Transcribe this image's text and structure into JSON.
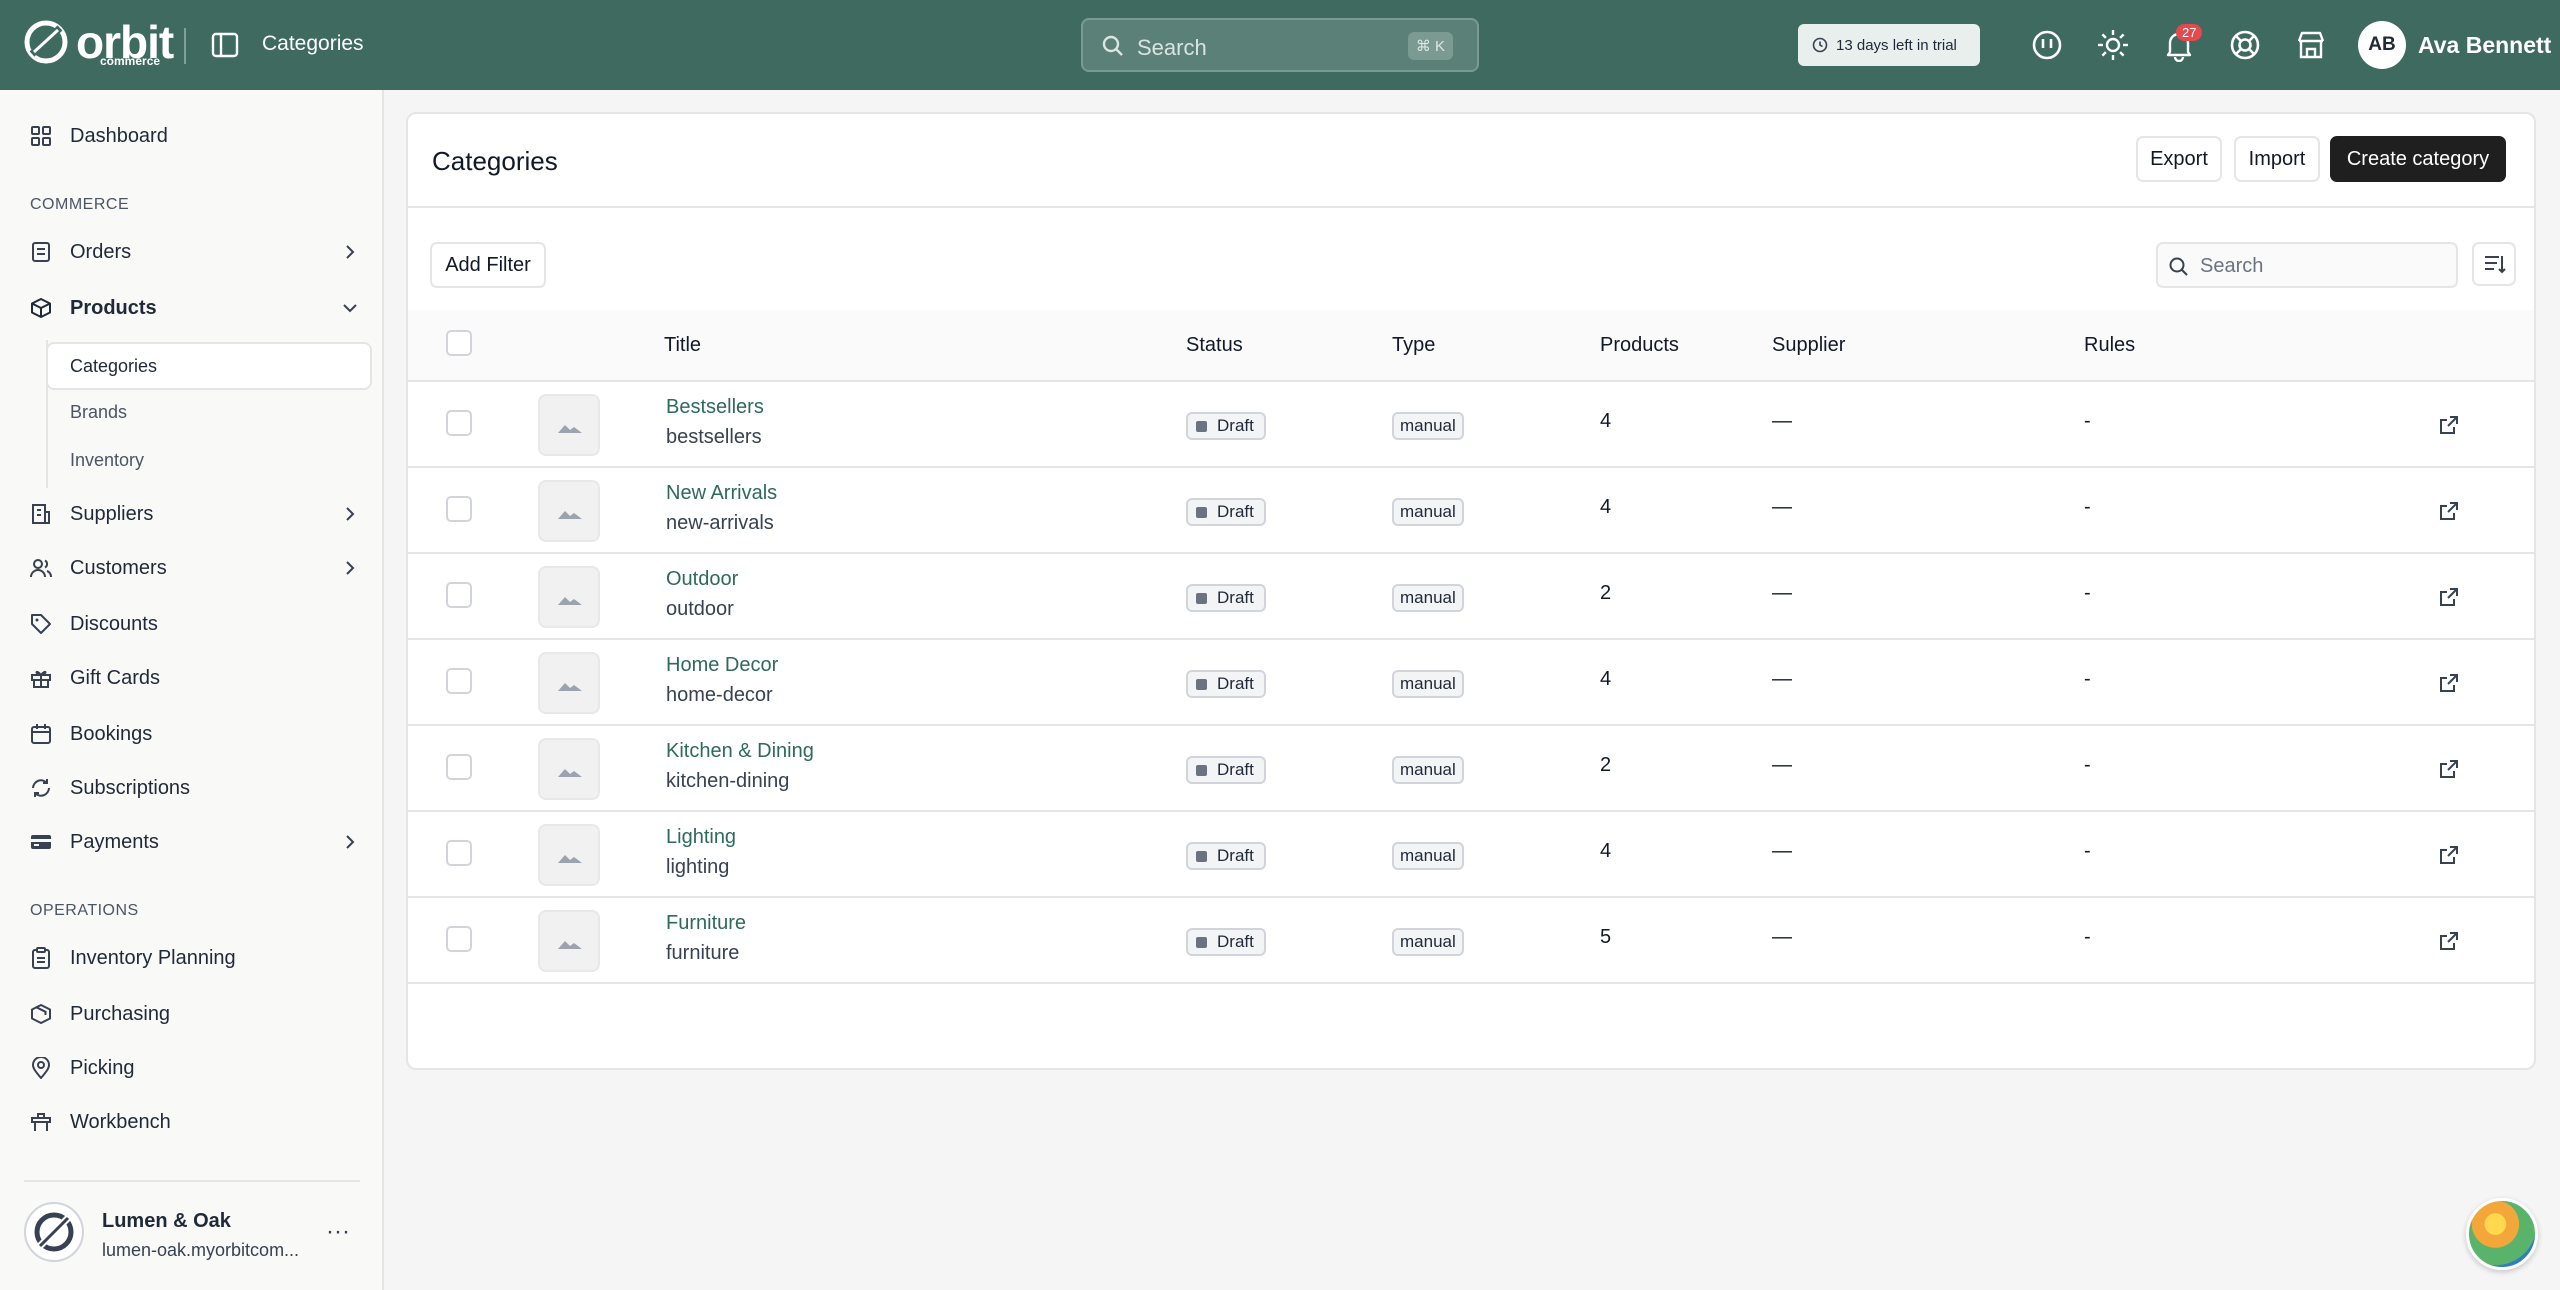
{
  "brand": {
    "name": "orbit",
    "sub": "commerce"
  },
  "header": {
    "breadcrumb": "Categories",
    "search_placeholder": "Search",
    "search_shortcut": "⌘ K",
    "trial_text": "13 days left in trial",
    "notifications_count": "27",
    "user_initials": "AB",
    "user_name": "Ava Bennett"
  },
  "sidebar": {
    "dashboard": "Dashboard",
    "commerce_label": "COMMERCE",
    "orders": "Orders",
    "products": "Products",
    "products_sub": [
      "Categories",
      "Brands",
      "Inventory"
    ],
    "suppliers": "Suppliers",
    "customers": "Customers",
    "discounts": "Discounts",
    "gift_cards": "Gift Cards",
    "bookings": "Bookings",
    "subscriptions": "Subscriptions",
    "payments": "Payments",
    "operations_label": "OPERATIONS",
    "inventory_planning": "Inventory Planning",
    "purchasing": "Purchasing",
    "picking": "Picking",
    "workbench": "Workbench",
    "store_name": "Lumen & Oak",
    "store_url": "lumen-oak.myorbitcom...",
    "more": "···"
  },
  "page": {
    "title": "Categories",
    "export_label": "Export",
    "import_label": "Import",
    "create_label": "Create category",
    "add_filter_label": "Add Filter",
    "search_placeholder": "Search"
  },
  "table": {
    "columns": [
      "Title",
      "Status",
      "Type",
      "Products",
      "Supplier",
      "Rules"
    ],
    "rows": [
      {
        "title": "Bestsellers",
        "handle": "bestsellers",
        "status": "Draft",
        "type": "manual",
        "products": "4",
        "supplier": "—",
        "rules": "-"
      },
      {
        "title": "New Arrivals",
        "handle": "new-arrivals",
        "status": "Draft",
        "type": "manual",
        "products": "4",
        "supplier": "—",
        "rules": "-"
      },
      {
        "title": "Outdoor",
        "handle": "outdoor",
        "status": "Draft",
        "type": "manual",
        "products": "2",
        "supplier": "—",
        "rules": "-"
      },
      {
        "title": "Home Decor",
        "handle": "home-decor",
        "status": "Draft",
        "type": "manual",
        "products": "4",
        "supplier": "—",
        "rules": "-"
      },
      {
        "title": "Kitchen & Dining",
        "handle": "kitchen-dining",
        "status": "Draft",
        "type": "manual",
        "products": "2",
        "supplier": "—",
        "rules": "-"
      },
      {
        "title": "Lighting",
        "handle": "lighting",
        "status": "Draft",
        "type": "manual",
        "products": "4",
        "supplier": "—",
        "rules": "-"
      },
      {
        "title": "Furniture",
        "handle": "furniture",
        "status": "Draft",
        "type": "manual",
        "products": "5",
        "supplier": "—",
        "rules": "-"
      }
    ]
  },
  "colors": {
    "header_bg": "#3e6a60",
    "link": "#2d6a5a",
    "primary_button": "#1f1f1f"
  }
}
